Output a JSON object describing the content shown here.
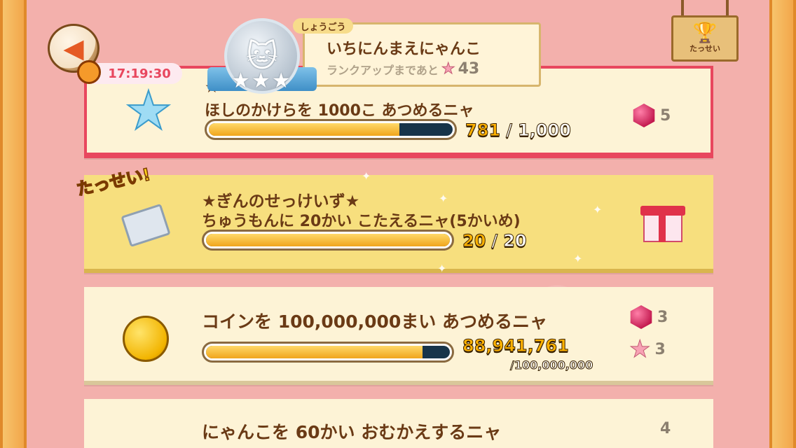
{
  "header": {
    "timer": "17:19:30",
    "rank_label": "しょうごう",
    "rank_title": "いちにんまえにゃんこ",
    "rank_next_text": "ランクアップまであと",
    "rank_next_count": "43",
    "achieve_label": "たっせい"
  },
  "missions": [
    {
      "title": "★",
      "description": "ほしのかけらを 1000こ あつめるニャ",
      "current": "781",
      "max": "1,000",
      "progress": 0.781,
      "reward_gem": "5"
    },
    {
      "badge": "たっせい!",
      "title": "★ぎんのせっけいず★",
      "description": "ちゅうもんに 20かい こたえるニャ(5かいめ)",
      "current": "20",
      "max": "20",
      "progress": 1.0
    },
    {
      "description": "コインを 100,000,000まい あつめるニャ",
      "current": "88,941,761",
      "max": "/100,000,000",
      "progress": 0.889,
      "reward_gem": "3",
      "reward_star": "3"
    },
    {
      "description": "にゃんこを 60かい おむかえするニャ",
      "reward_gem": "4"
    }
  ]
}
